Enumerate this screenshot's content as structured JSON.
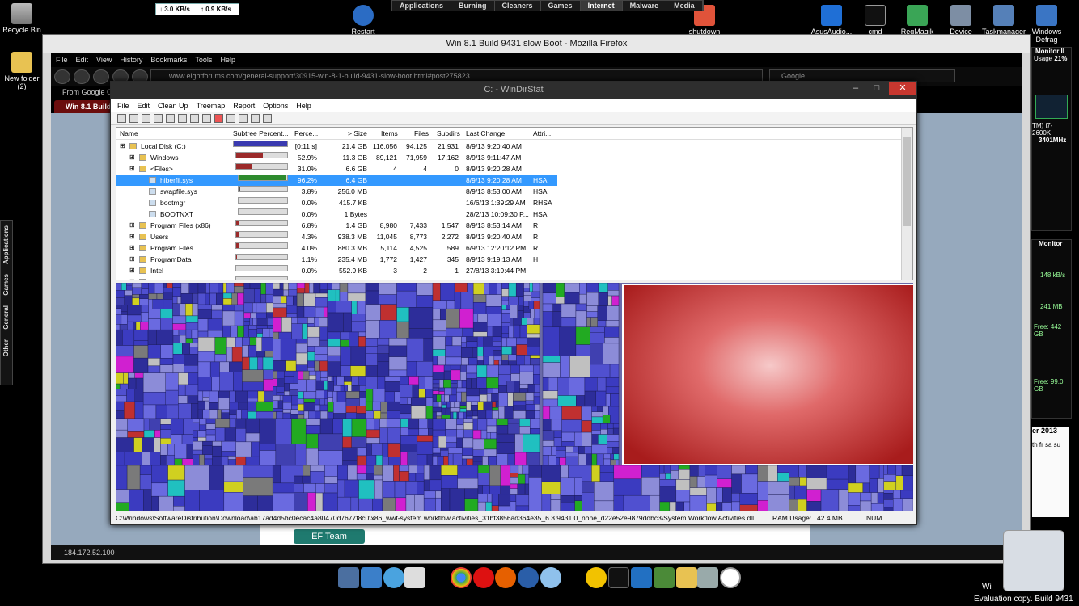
{
  "desktop": {
    "recycle_bin": "Recycle Bin",
    "new_folder": "New folder\n(2)",
    "restart": "Restart",
    "shutdown": "shutdown",
    "icons_right": [
      "AsusAudio...",
      "cmd",
      "RegMagik",
      "Device",
      "Taskmanager",
      "Windows\nDefrag"
    ]
  },
  "netmeter": {
    "down": "3.0 KB/s",
    "up": "0.9 KB/s"
  },
  "topbar": {
    "tabs": [
      "Applications",
      "Burning",
      "Cleaners",
      "Games",
      "Internet",
      "Malware",
      "Media"
    ],
    "active": "Internet"
  },
  "side_tabs": [
    "Applications",
    "Games",
    "General",
    "Other"
  ],
  "firefox": {
    "title": "Win 8.1 Build 9431 slow Boot - Mozilla Firefox",
    "menu": [
      "File",
      "Edit",
      "View",
      "History",
      "Bookmarks",
      "Tools",
      "Help"
    ],
    "url": "www.eightforums.com/general-support/30915-win-8-1-build-9431-slow-boot.html#post275823",
    "search_placeholder": "Google",
    "bookmark": "From Google C",
    "tab": "Win 8.1 Build",
    "status": "184.172.52.100",
    "ef_team": "EF Team"
  },
  "windirstat": {
    "title": "C: - WinDirStat",
    "menu": [
      "File",
      "Edit",
      "Clean Up",
      "Treemap",
      "Report",
      "Options",
      "Help"
    ],
    "columns": [
      "Name",
      "Subtree Percent...",
      "Perce...",
      "> Size",
      "Items",
      "Files",
      "Subdirs",
      "Last Change",
      "Attri..."
    ],
    "rows": [
      {
        "name": "Local Disk (C:)",
        "pct_text": "[0:11 s]",
        "bar": 1.0,
        "size": "21.4 GB",
        "items": "116,056",
        "files": "94,125",
        "subdirs": "21,931",
        "change": "8/9/13  9:20:40 AM",
        "attr": "",
        "indent": 0,
        "color": "#3a3ab0"
      },
      {
        "name": "Windows",
        "pct_text": "52.9%",
        "bar": 0.529,
        "size": "11.3 GB",
        "items": "89,121",
        "files": "71,959",
        "subdirs": "17,162",
        "change": "8/9/13  9:11:47 AM",
        "attr": "",
        "indent": 1,
        "color": "#9b2a2a"
      },
      {
        "name": "<Files>",
        "pct_text": "31.0%",
        "bar": 0.31,
        "size": "6.6 GB",
        "items": "4",
        "files": "4",
        "subdirs": "0",
        "change": "8/9/13  9:20:28 AM",
        "attr": "",
        "indent": 1,
        "color": "#9b2a2a"
      },
      {
        "name": "hiberfil.sys",
        "pct_text": "96.2%",
        "bar": 0.962,
        "size": "6.4 GB",
        "items": "",
        "files": "",
        "subdirs": "",
        "change": "8/9/13  9:20:28 AM",
        "attr": "HSA",
        "indent": 2,
        "color": "#2e8b2e",
        "selected": true
      },
      {
        "name": "swapfile.sys",
        "pct_text": "3.8%",
        "bar": 0.038,
        "size": "256.0 MB",
        "items": "",
        "files": "",
        "subdirs": "",
        "change": "8/9/13  8:53:00 AM",
        "attr": "HSA",
        "indent": 2,
        "color": "#555"
      },
      {
        "name": "bootmgr",
        "pct_text": "0.0%",
        "bar": 0.0,
        "size": "415.7 KB",
        "items": "",
        "files": "",
        "subdirs": "",
        "change": "16/6/13  1:39:29 AM",
        "attr": "RHSA",
        "indent": 2,
        "color": "#555"
      },
      {
        "name": "BOOTNXT",
        "pct_text": "0.0%",
        "bar": 0.0,
        "size": "1 Bytes",
        "items": "",
        "files": "",
        "subdirs": "",
        "change": "28/2/13  10:09:30 P...",
        "attr": "HSA",
        "indent": 2,
        "color": "#555"
      },
      {
        "name": "Program Files (x86)",
        "pct_text": "6.8%",
        "bar": 0.068,
        "size": "1.4 GB",
        "items": "8,980",
        "files": "7,433",
        "subdirs": "1,547",
        "change": "8/9/13  8:53:14 AM",
        "attr": "R",
        "indent": 1,
        "color": "#9b2a2a"
      },
      {
        "name": "Users",
        "pct_text": "4.3%",
        "bar": 0.043,
        "size": "938.3 MB",
        "items": "11,045",
        "files": "8,773",
        "subdirs": "2,272",
        "change": "8/9/13  9:20:40 AM",
        "attr": "R",
        "indent": 1,
        "color": "#9b2a2a"
      },
      {
        "name": "Program Files",
        "pct_text": "4.0%",
        "bar": 0.04,
        "size": "880.3 MB",
        "items": "5,114",
        "files": "4,525",
        "subdirs": "589",
        "change": "6/9/13  12:20:12 PM",
        "attr": "R",
        "indent": 1,
        "color": "#9b2a2a"
      },
      {
        "name": "ProgramData",
        "pct_text": "1.1%",
        "bar": 0.011,
        "size": "235.4 MB",
        "items": "1,772",
        "files": "1,427",
        "subdirs": "345",
        "change": "8/9/13  9:19:13 AM",
        "attr": "H",
        "indent": 1,
        "color": "#9b2a2a"
      },
      {
        "name": "Intel",
        "pct_text": "0.0%",
        "bar": 0.0,
        "size": "552.9 KB",
        "items": "3",
        "files": "2",
        "subdirs": "1",
        "change": "27/8/13  3:19:44 PM",
        "attr": "",
        "indent": 1,
        "color": "#9b2a2a"
      },
      {
        "name": "$Recycle.Bin",
        "pct_text": "0.0%",
        "bar": 0.0,
        "size": "120 Bytes",
        "items": "3",
        "files": "1",
        "subdirs": "2",
        "change": "7/9/13  9:24:16 AM",
        "attr": "HS",
        "indent": 1,
        "color": "#9b2a2a"
      }
    ],
    "status_path": "C:\\Windows\\SoftwareDistribution\\Download\\ab17ad4d5bc0ecac4a80470d7677f8c0\\x86_wwf-system.workflow.activities_31bf3856ad364e35_6.3.9431.0_none_d22e52e9879ddbc3\\System.Workflow.Activities.dll",
    "ram_label": "RAM Usage:",
    "ram_value": "42.4 MB",
    "num": "NUM"
  },
  "gadgets": {
    "monitor_title": "Monitor II",
    "usage_label": "Usage",
    "usage_value": "21%",
    "cpu_model": "TM) i7-2600K",
    "cpu_freq": "3401MHz",
    "net_title": "Monitor",
    "net_down": "148 kB/s",
    "net_mem": "241 MB",
    "free_1": "Free: 442 GB",
    "free_2": "Free: 99.0 GB",
    "calendar_title": "er 2013",
    "calendar_days": "th fr sa su"
  },
  "bottom": {
    "evaluation": "Evaluation copy. Build 9431",
    "windows": "Wi"
  }
}
